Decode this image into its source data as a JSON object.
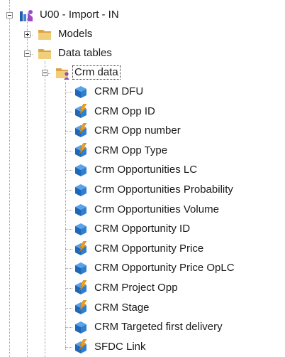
{
  "tree": {
    "root": {
      "label": "U00 - Import - IN",
      "icon": "model-root-icon",
      "expanded": true
    },
    "children": [
      {
        "label": "Models",
        "icon": "folder-icon",
        "expanded": false
      },
      {
        "label": "Data tables",
        "icon": "folder-icon",
        "expanded": true,
        "children": [
          {
            "label": "Crm data",
            "icon": "user-folder-icon",
            "expanded": true,
            "focused": true,
            "items": [
              {
                "label": "CRM DFU",
                "icon": "cube-icon"
              },
              {
                "label": "CRM Opp  ID",
                "icon": "cube-lightning-icon"
              },
              {
                "label": "CRM Opp number",
                "icon": "cube-lightning-icon"
              },
              {
                "label": "CRM Opp Type",
                "icon": "cube-lightning-icon"
              },
              {
                "label": "Crm Opportunities LC",
                "icon": "cube-icon"
              },
              {
                "label": "Crm Opportunities Probability",
                "icon": "cube-icon"
              },
              {
                "label": "Crm Opportunities Volume",
                "icon": "cube-icon"
              },
              {
                "label": "CRM Opportunity ID",
                "icon": "cube-icon"
              },
              {
                "label": "CRM Opportunity Price",
                "icon": "cube-lightning-icon"
              },
              {
                "label": "CRM Opportunity Price OpLC",
                "icon": "cube-icon"
              },
              {
                "label": "CRM Project Opp",
                "icon": "cube-lightning-icon"
              },
              {
                "label": "CRM Stage",
                "icon": "cube-lightning-icon"
              },
              {
                "label": "CRM Targeted first delivery",
                "icon": "cube-icon"
              },
              {
                "label": "SFDC Link",
                "icon": "cube-lightning-icon"
              }
            ]
          }
        ]
      }
    ]
  },
  "colors": {
    "cube_blue": "#2a73c4",
    "lightning_orange": "#f0a020",
    "folder_yellow": "#e8c060",
    "user_purple": "#8a4ab8"
  }
}
